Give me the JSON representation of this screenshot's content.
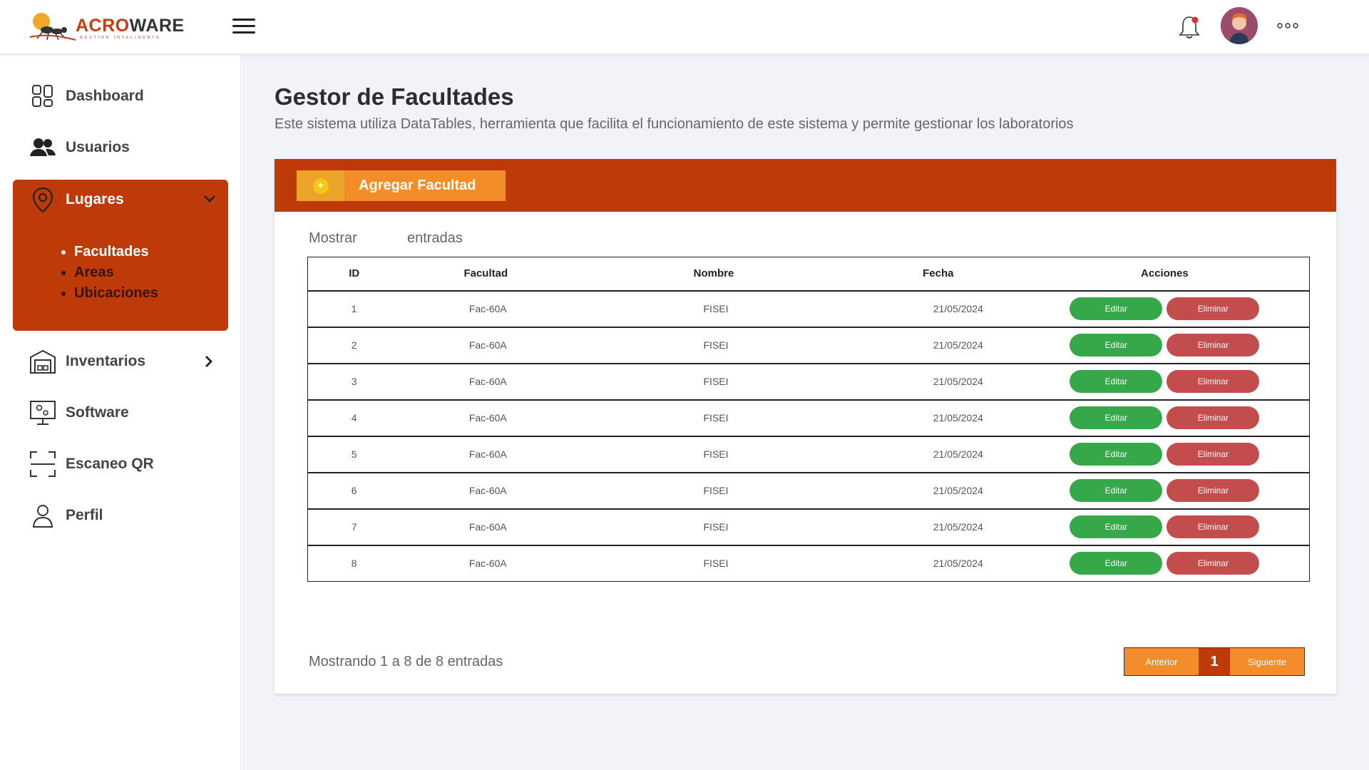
{
  "brand": {
    "name_part1": "ACRO",
    "name_part2": "WARE",
    "tagline": "GESTION INTELIGENTE"
  },
  "icons": {
    "menu": "hamburger-icon",
    "notifications": "bell-icon",
    "user": "avatar",
    "more": "more-dots-icon"
  },
  "colors": {
    "primary": "#bf3a09",
    "orange": "#f28d2a",
    "edit": "#36a84a",
    "delete": "#c24d4c"
  },
  "sidebar": {
    "items": [
      {
        "label": "Dashboard",
        "icon": "dashboard-icon"
      },
      {
        "label": "Usuarios",
        "icon": "users-icon"
      },
      {
        "label": "Lugares",
        "icon": "location-pin-icon"
      },
      {
        "label": "Inventarios",
        "icon": "warehouse-icon"
      },
      {
        "label": "Software",
        "icon": "software-monitor-icon"
      },
      {
        "label": "Escaneo QR",
        "icon": "qr-scan-icon"
      },
      {
        "label": "Perfil",
        "icon": "profile-icon"
      }
    ],
    "lugares_sub": [
      "Facultades",
      "Areas",
      "Ubicaciones"
    ]
  },
  "page": {
    "title": "Gestor de Facultades",
    "subtitle": "Este sistema utiliza DataTables, herramienta que facilita el funcionamiento de este sistema y permite gestionar los laboratorios"
  },
  "toolbar": {
    "add_label": "Agregar Facultad",
    "show_label": "Mostrar",
    "entries_label": "entradas"
  },
  "table": {
    "headers": [
      "ID",
      "Facultad",
      "Nombre",
      "Fecha",
      "Acciones"
    ],
    "edit_label": "Editar",
    "delete_label": "Eliminar",
    "rows": [
      {
        "id": "1",
        "facultad": "Fac-60A",
        "nombre": "FISEI",
        "fecha": "21/05/2024"
      },
      {
        "id": "2",
        "facultad": "Fac-60A",
        "nombre": "FISEI",
        "fecha": "21/05/2024"
      },
      {
        "id": "3",
        "facultad": "Fac-60A",
        "nombre": "FISEI",
        "fecha": "21/05/2024"
      },
      {
        "id": "4",
        "facultad": "Fac-60A",
        "nombre": "FISEI",
        "fecha": "21/05/2024"
      },
      {
        "id": "5",
        "facultad": "Fac-60A",
        "nombre": "FISEI",
        "fecha": "21/05/2024"
      },
      {
        "id": "6",
        "facultad": "Fac-60A",
        "nombre": "FISEI",
        "fecha": "21/05/2024"
      },
      {
        "id": "7",
        "facultad": "Fac-60A",
        "nombre": "FISEI",
        "fecha": "21/05/2024"
      },
      {
        "id": "8",
        "facultad": "Fac-60A",
        "nombre": "FISEI",
        "fecha": "21/05/2024"
      }
    ]
  },
  "footer": {
    "showing": "Mostrando 1 a 8 de 8 entradas",
    "prev": "Anterior",
    "current_page": "1",
    "next": "Siguiente"
  }
}
